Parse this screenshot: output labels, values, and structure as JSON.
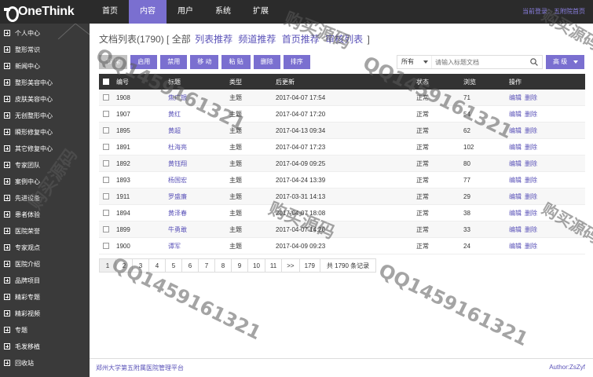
{
  "logo": "OneThink",
  "topnav": [
    "首页",
    "内容",
    "用户",
    "系统",
    "扩展"
  ],
  "login_info": "当前登录：五附院首页",
  "sidebar": [
    "个人中心",
    "整形常识",
    "新闻中心",
    "整形美容中心",
    "皮肤美容中心",
    "无创整形中心",
    "瞬形修复中心",
    "其它修复中心",
    "专家团队",
    "案例中心",
    "先进设备",
    "患者体验",
    "医院荣誉",
    "专家观点",
    "医院介绍",
    "品牌项目",
    "精彩专题",
    "精彩视频",
    "专题",
    "毛发移植",
    "回收站"
  ],
  "page_title": {
    "prefix": "文档列表(1790) [",
    "all": "全部",
    "links": [
      "列表推荐",
      "频道推荐",
      "首页推荐",
      "审核列表"
    ],
    "suffix": "]"
  },
  "toolbar": [
    "节 常",
    "启用",
    "禁用",
    "移 动",
    "粘 贴",
    "删除",
    "排序"
  ],
  "search": {
    "select": "所有",
    "placeholder": "请输入标题文档"
  },
  "advanced": "高 级",
  "table": {
    "headers": [
      "编号",
      "标题",
      "类型",
      "后更新",
      "状态",
      "浏览",
      "操作"
    ],
    "rows": [
      [
        "1908",
        "焦广银",
        "主题",
        "2017-04-07 17:54",
        "正常",
        "71"
      ],
      [
        "1907",
        "黄红",
        "主题",
        "2017-04-07 17:20",
        "正常",
        "54"
      ],
      [
        "1895",
        "黄超",
        "主题",
        "2017-04-13 09:34",
        "正常",
        "62"
      ],
      [
        "1891",
        "杜海亮",
        "主题",
        "2017-04-07 17:23",
        "正常",
        "102"
      ],
      [
        "1892",
        "黄钰翔",
        "主题",
        "2017-04-09 09:25",
        "正常",
        "80"
      ],
      [
        "1893",
        "杨国宏",
        "主题",
        "2017-04-24 13:39",
        "正常",
        "77"
      ],
      [
        "1911",
        "罗盛廉",
        "主题",
        "2017-03-31 14:13",
        "正常",
        "29"
      ],
      [
        "1894",
        "黄泽春",
        "主题",
        "2017-04-07 18:08",
        "正常",
        "38"
      ],
      [
        "1899",
        "牛勇敢",
        "主题",
        "2017-04-07 14:20",
        "正常",
        "33"
      ],
      [
        "1900",
        "谭军",
        "主题",
        "2017-04-09 09:23",
        "正常",
        "24"
      ]
    ],
    "op_edit": "编辑",
    "op_delete": "删除"
  },
  "pagination": [
    "1",
    "2",
    "3",
    "4",
    "5",
    "6",
    "7",
    "8",
    "9",
    "10",
    "11",
    ">>",
    "179"
  ],
  "pagination_info": "共 1790 条记录",
  "footer_left": "郑州大学第五附属医院管理平台",
  "footer_right": "Author:ZsZyf",
  "watermark": {
    "text1": "购买源码",
    "text2": "QQ1459161321"
  },
  "colors": {
    "accent": "#7a6fd0",
    "header_bg": "#2b2b2b",
    "sidebar_bg": "#3a3a3a",
    "link": "#5a52b8"
  }
}
